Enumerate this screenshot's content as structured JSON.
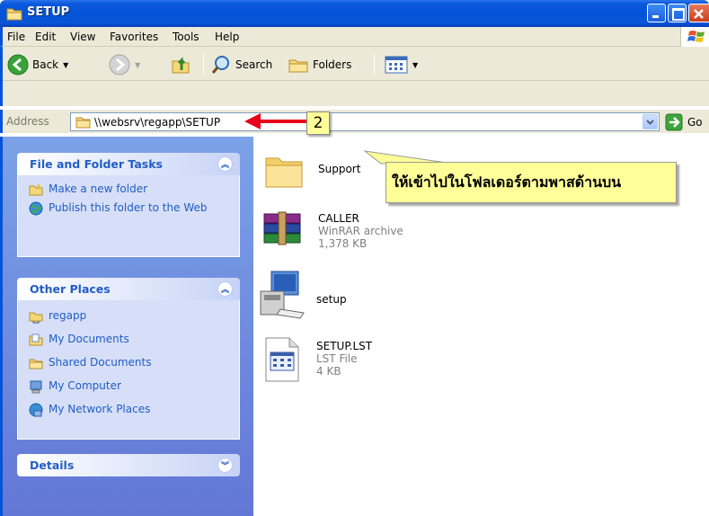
{
  "window": {
    "title": "SETUP"
  },
  "menu": [
    "File",
    "Edit",
    "View",
    "Favorites",
    "Tools",
    "Help"
  ],
  "toolbar": {
    "back_label": "Back",
    "search_label": "Search",
    "folders_label": "Folders"
  },
  "address": {
    "label": "Address",
    "value": "\\\\websrv\\regapp\\SETUP",
    "go_label": "Go"
  },
  "tasks_panel": {
    "title": "File and Folder Tasks",
    "items": [
      "Make a new folder",
      "Publish this folder to the Web"
    ]
  },
  "places_panel": {
    "title": "Other Places",
    "items": [
      "regapp",
      "My Documents",
      "Shared Documents",
      "My Computer",
      "My Network Places"
    ]
  },
  "details_panel": {
    "title": "Details"
  },
  "files": [
    {
      "name": "Support",
      "type": "",
      "size": ""
    },
    {
      "name": "CALLER",
      "type": "WinRAR archive",
      "size": "1,378 KB"
    },
    {
      "name": "setup",
      "type": "",
      "size": ""
    },
    {
      "name": "SETUP.LST",
      "type": "LST File",
      "size": "4 KB"
    }
  ],
  "annotation": {
    "callout_text": "ให้เข้าไปในโฟลเดอร์ตามพาสด้านบน",
    "step_number": "2"
  },
  "colors": {
    "titlebar": "#0553d6",
    "panel_title": "#215dc6",
    "callout_bg": "#ffff99",
    "arrow": "#e8001a"
  }
}
